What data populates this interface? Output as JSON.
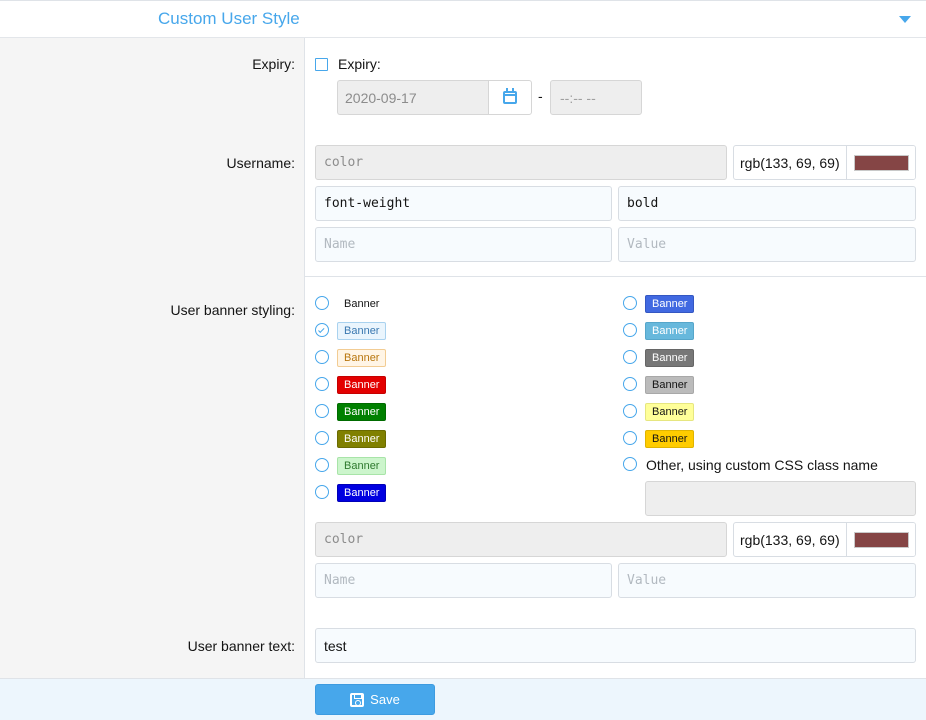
{
  "header": {
    "title": "Custom User Style"
  },
  "expiry": {
    "label": "Expiry:",
    "checkbox_label": "Expiry:",
    "date_value": "2020-09-17",
    "time_placeholder": "--:--  --"
  },
  "username": {
    "label": "Username:",
    "rows": [
      {
        "name": "color",
        "value": "rgb(133, 69, 69)",
        "swatch": "#854545"
      },
      {
        "name": "font-weight",
        "value": "bold"
      },
      {
        "name_placeholder": "Name",
        "value_placeholder": "Value"
      }
    ]
  },
  "banner_styling": {
    "label": "User banner styling:",
    "options": [
      {
        "text": "Banner",
        "bg": "transparent",
        "fg": "#141414",
        "border": "transparent",
        "checked": false
      },
      {
        "text": "Banner",
        "bg": "#eaf5fd",
        "fg": "#3a78b0",
        "border": "#a9d2ef",
        "checked": true
      },
      {
        "text": "Banner",
        "bg": "#fff5e6",
        "fg": "#b8760e",
        "border": "#f2cc93",
        "checked": false
      },
      {
        "text": "Banner",
        "bg": "#e30000",
        "fg": "#ffffff",
        "border": "#c50000",
        "checked": false
      },
      {
        "text": "Banner",
        "bg": "#008000",
        "fg": "#ffffff",
        "border": "#006b00",
        "checked": false
      },
      {
        "text": "Banner",
        "bg": "#808000",
        "fg": "#ffffff",
        "border": "#6b6b00",
        "checked": false
      },
      {
        "text": "Banner",
        "bg": "#ccf5cc",
        "fg": "#2f7a2f",
        "border": "#a8e4a8",
        "checked": false
      },
      {
        "text": "Banner",
        "bg": "#0000e0",
        "fg": "#ffffff",
        "border": "#0000b8",
        "checked": false
      },
      {
        "text": "Banner",
        "bg": "#4169e1",
        "fg": "#ffffff",
        "border": "#3457c2",
        "checked": false
      },
      {
        "text": "Banner",
        "bg": "#67b8dc",
        "fg": "#ffffff",
        "border": "#56a6ca",
        "checked": false
      },
      {
        "text": "Banner",
        "bg": "#777777",
        "fg": "#ffffff",
        "border": "#666666",
        "checked": false
      },
      {
        "text": "Banner",
        "bg": "#bbbbbb",
        "fg": "#141414",
        "border": "#a8a8a8",
        "checked": false
      },
      {
        "text": "Banner",
        "bg": "#ffff99",
        "fg": "#141414",
        "border": "#e6e680",
        "checked": false
      },
      {
        "text": "Banner",
        "bg": "#ffcc00",
        "fg": "#141414",
        "border": "#e0b400",
        "checked": false
      }
    ],
    "other_label": "Other, using custom CSS class name",
    "rows": [
      {
        "name": "color",
        "value": "rgb(133, 69, 69)",
        "swatch": "#854545"
      },
      {
        "name_placeholder": "Name",
        "value_placeholder": "Value"
      }
    ]
  },
  "banner_text": {
    "label": "User banner text:",
    "value": "test"
  },
  "footer": {
    "save_label": "Save"
  },
  "colors": {
    "accent": "#47a7eb"
  }
}
